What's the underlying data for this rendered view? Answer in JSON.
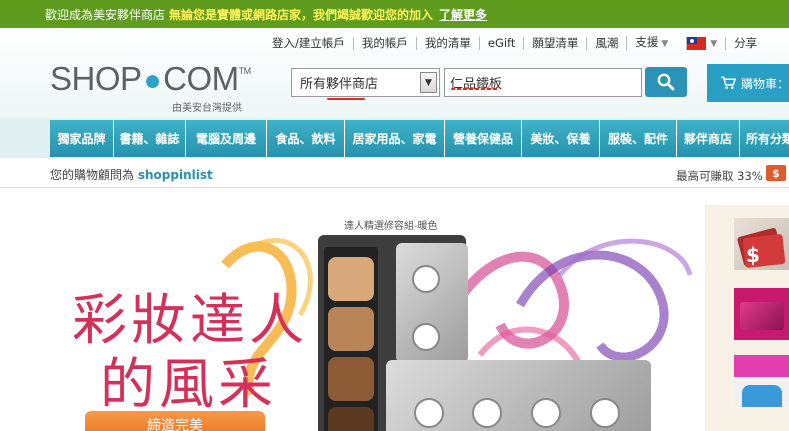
{
  "banner": {
    "welcome": "歡迎成為美安夥伴商店",
    "highlight": "無論您是實體或網路店家，我們竭誠歡迎您的加入",
    "learn_more": "了解更多"
  },
  "toplinks": {
    "login": "登入/建立帳戶",
    "account": "我的帳戶",
    "list": "我的清單",
    "egift": "eGift",
    "wishlist": "願望清單",
    "trend": "風潮",
    "support": "支援",
    "share": "分享"
  },
  "logo": {
    "left": "SHOP",
    "right": "COM",
    "tm": "TM",
    "tagline": "由美安台灣提供"
  },
  "search": {
    "store_select": "所有夥伴商店",
    "query": "仁品鐵板"
  },
  "cart": {
    "label": "購物車："
  },
  "nav": {
    "items": [
      "獨家品牌",
      "書籍、雜誌",
      "電腦及周邊",
      "食品、飲料",
      "居家用品、家電",
      "營養保健品",
      "美妝、保養",
      "服裝、配件",
      "夥伴商店",
      "所有分類"
    ]
  },
  "infobar": {
    "advisor_prefix": "您的購物顧問為",
    "advisor_name": "shoppinlist",
    "earn": "最高可賺取 33%",
    "earn_icon": "$"
  },
  "hero": {
    "caption": "達人精選修容組-暖色",
    "title_line1": "彩妝達人",
    "title_line2": "的風采",
    "cta": "締造完美"
  },
  "colors": {
    "banner": "#5f9c1e",
    "accent": "#2a9fc6",
    "title": "#d4315a"
  }
}
